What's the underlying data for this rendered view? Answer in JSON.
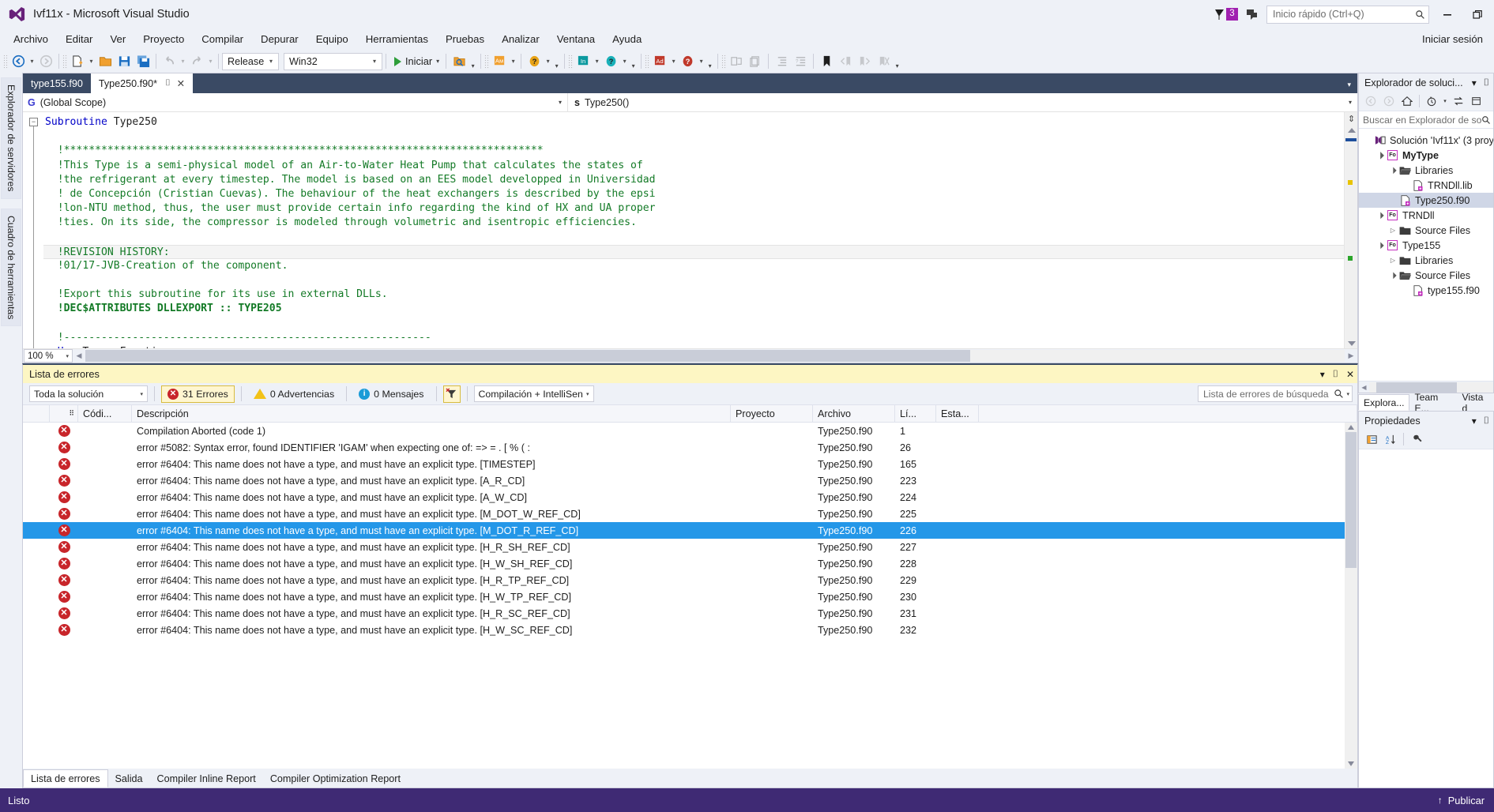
{
  "window": {
    "title": "Ivf11x - Microsoft Visual Studio",
    "logo_icon": "visual-studio-logo",
    "notifications": {
      "flag_icon": "flag-icon",
      "count": "3"
    },
    "feedback_icon": "feedback-icon",
    "quick_launch": {
      "placeholder": "Inicio rápido (Ctrl+Q)",
      "value": "",
      "search_icon": "search-icon"
    },
    "minimize": "—",
    "restore": "❐"
  },
  "menu": {
    "items": [
      "Archivo",
      "Editar",
      "Ver",
      "Proyecto",
      "Compilar",
      "Depurar",
      "Equipo",
      "Herramientas",
      "Pruebas",
      "Analizar",
      "Ventana",
      "Ayuda"
    ],
    "signin": "Iniciar sesión"
  },
  "toolbar": {
    "nav_back_icon": "navigate-back-icon",
    "nav_forward_icon": "navigate-forward-icon",
    "new_project_icon": "new-project-icon",
    "open_file_icon": "open-file-icon",
    "save_icon": "save-icon",
    "save_all_icon": "save-all-icon",
    "undo_icon": "undo-icon",
    "redo_icon": "redo-icon",
    "configuration": "Release",
    "platform": "Win32",
    "start_label": "Iniciar",
    "start_icon": "play-icon",
    "find_icon": "find-in-files-icon",
    "am_icon": "ampere-tool-icon",
    "help1_icon": "help-icon",
    "in_icon": "intel-inspector-icon",
    "help2_icon": "help-icon",
    "ad_icon": "advisor-icon",
    "help3_icon": "help-icon",
    "comment_icon": "comment-icon",
    "uncomment_icon": "uncomment-icon",
    "indent_icon": "increase-indent-icon",
    "outdent_icon": "decrease-indent-icon",
    "bookmark_icon": "bookmark-icon",
    "prev_bookmark_icon": "previous-bookmark-icon",
    "next_bookmark_icon": "next-bookmark-icon",
    "clear_bookmark_icon": "clear-bookmarks-icon"
  },
  "left_dock": {
    "tabs": [
      "Explorador de servidores",
      "Cuadro de herramientas"
    ]
  },
  "editor": {
    "tabs": [
      {
        "label": "type155.f90",
        "active": false
      },
      {
        "label": "Type250.f90*",
        "active": true,
        "pin_icon": "pin-icon",
        "close_icon": "close-icon"
      }
    ],
    "scope_badge": "G",
    "scope_value": "(Global Scope)",
    "member_badge": "s",
    "member_value": "Type250()",
    "zoom": "100 %",
    "lines": [
      {
        "indent": 0,
        "fold": true,
        "parts": [
          {
            "t": "Subroutine ",
            "c": "kw"
          },
          {
            "t": "Type250",
            "c": "id"
          }
        ]
      },
      {
        "indent": 1,
        "parts": []
      },
      {
        "indent": 1,
        "parts": [
          {
            "t": "!*****************************************************************************",
            "c": "cm"
          }
        ]
      },
      {
        "indent": 1,
        "parts": [
          {
            "t": "!This Type is a semi-physical model of an Air-to-Water Heat Pump that calculates the states of",
            "c": "cm"
          }
        ]
      },
      {
        "indent": 1,
        "parts": [
          {
            "t": "!the refrigerant at every timestep. The model is based on an EES model developped in Universidad",
            "c": "cm"
          }
        ]
      },
      {
        "indent": 1,
        "parts": [
          {
            "t": "! de Concepción (Cristian Cuevas). The behaviour of the heat exchangers is described by the epsi",
            "c": "cm"
          }
        ]
      },
      {
        "indent": 1,
        "parts": [
          {
            "t": "!lon-NTU method, thus, the user must provide certain info regarding the kind of HX and UA proper",
            "c": "cm"
          }
        ]
      },
      {
        "indent": 1,
        "parts": [
          {
            "t": "!ties. On its side, the compressor is modeled through volumetric and isentropic efficiencies.",
            "c": "cm"
          }
        ]
      },
      {
        "indent": 1,
        "parts": []
      },
      {
        "indent": 1,
        "current": true,
        "parts": [
          {
            "t": "!REVISION HISTORY:",
            "c": "cm"
          }
        ]
      },
      {
        "indent": 1,
        "parts": [
          {
            "t": "!01/17-JVB-Creation of the component.",
            "c": "cm"
          }
        ]
      },
      {
        "indent": 1,
        "parts": []
      },
      {
        "indent": 1,
        "parts": [
          {
            "t": "!Export this subroutine for its use in external DLLs.",
            "c": "cm"
          }
        ]
      },
      {
        "indent": 1,
        "parts": [
          {
            "t": "!DEC$ATTRIBUTES DLLEXPORT :: TYPE205",
            "c": "cm",
            "b": true
          }
        ]
      },
      {
        "indent": 1,
        "parts": []
      },
      {
        "indent": 1,
        "parts": [
          {
            "t": "!-----------------------------------------------------------",
            "c": "cm"
          }
        ]
      },
      {
        "indent": 1,
        "parts": [
          {
            "t": "Use ",
            "c": "kw"
          },
          {
            "t": "TrnsysFunctions",
            "c": "id"
          }
        ]
      }
    ]
  },
  "error_list": {
    "title": "Lista de errores",
    "dropdown_icon": "chevron-down-icon",
    "pin_icon": "pin-icon",
    "close_icon": "close-icon",
    "scope_filter": "Toda la solución",
    "errors_label": "31 Errores",
    "warnings_label": "0 Advertencias",
    "messages_label": "0 Mensajes",
    "filter_icon": "clear-filter-icon",
    "build_filter": "Compilación + IntelliSen",
    "search_placeholder": "Lista de errores de búsqueda",
    "search_icon": "search-icon",
    "columns": [
      "",
      "",
      "Códi...",
      "Descripción",
      "Proyecto",
      "Archivo",
      "Lí...",
      "Esta..."
    ],
    "rows": [
      {
        "code": "",
        "desc": "Compilation Aborted (code 1)",
        "project": "",
        "file": "Type250.f90",
        "line": "1",
        "state": "",
        "selected": false
      },
      {
        "code": "",
        "desc": "error #5082: Syntax error, found IDENTIFIER 'IGAM' when expecting one of: => = . [ % ( :",
        "project": "",
        "file": "Type250.f90",
        "line": "26",
        "state": "",
        "selected": false
      },
      {
        "code": "",
        "desc": "error #6404: This name does not have a type, and must have an explicit type.   [TIMESTEP]",
        "project": "",
        "file": "Type250.f90",
        "line": "165",
        "state": "",
        "selected": false
      },
      {
        "code": "",
        "desc": "error #6404: This name does not have a type, and must have an explicit type.   [A_R_CD]",
        "project": "",
        "file": "Type250.f90",
        "line": "223",
        "state": "",
        "selected": false
      },
      {
        "code": "",
        "desc": "error #6404: This name does not have a type, and must have an explicit type.   [A_W_CD]",
        "project": "",
        "file": "Type250.f90",
        "line": "224",
        "state": "",
        "selected": false
      },
      {
        "code": "",
        "desc": "error #6404: This name does not have a type, and must have an explicit type.   [M_DOT_W_REF_CD]",
        "project": "",
        "file": "Type250.f90",
        "line": "225",
        "state": "",
        "selected": false
      },
      {
        "code": "",
        "desc": "error #6404: This name does not have a type, and must have an explicit type.   [M_DOT_R_REF_CD]",
        "project": "",
        "file": "Type250.f90",
        "line": "226",
        "state": "",
        "selected": true
      },
      {
        "code": "",
        "desc": "error #6404: This name does not have a type, and must have an explicit type.   [H_R_SH_REF_CD]",
        "project": "",
        "file": "Type250.f90",
        "line": "227",
        "state": "",
        "selected": false
      },
      {
        "code": "",
        "desc": "error #6404: This name does not have a type, and must have an explicit type.   [H_W_SH_REF_CD]",
        "project": "",
        "file": "Type250.f90",
        "line": "228",
        "state": "",
        "selected": false
      },
      {
        "code": "",
        "desc": "error #6404: This name does not have a type, and must have an explicit type.   [H_R_TP_REF_CD]",
        "project": "",
        "file": "Type250.f90",
        "line": "229",
        "state": "",
        "selected": false
      },
      {
        "code": "",
        "desc": "error #6404: This name does not have a type, and must have an explicit type.   [H_W_TP_REF_CD]",
        "project": "",
        "file": "Type250.f90",
        "line": "230",
        "state": "",
        "selected": false
      },
      {
        "code": "",
        "desc": "error #6404: This name does not have a type, and must have an explicit type.   [H_R_SC_REF_CD]",
        "project": "",
        "file": "Type250.f90",
        "line": "231",
        "state": "",
        "selected": false
      },
      {
        "code": "",
        "desc": "error #6404: This name does not have a type, and must have an explicit type.   [H_W_SC_REF_CD]",
        "project": "",
        "file": "Type250.f90",
        "line": "232",
        "state": "",
        "selected": false
      }
    ],
    "bottom_tabs": [
      {
        "label": "Lista de errores",
        "active": true
      },
      {
        "label": "Salida",
        "active": false
      },
      {
        "label": "Compiler Inline Report",
        "active": false
      },
      {
        "label": "Compiler Optimization Report",
        "active": false
      }
    ]
  },
  "solution_explorer": {
    "title": "Explorador de soluci...",
    "dropdown_icon": "chevron-down-icon",
    "pin_icon": "pin-icon",
    "toolbar": {
      "back_icon": "navigate-back-icon",
      "forward_icon": "navigate-forward-icon",
      "home_icon": "home-icon",
      "pending_changes_icon": "pending-changes-icon",
      "sync_icon": "sync-with-active-document-icon",
      "properties_icon": "properties-window-icon"
    },
    "search_placeholder": "Buscar en Explorador de so",
    "search_icon": "search-icon",
    "tree": [
      {
        "depth": 0,
        "twisty": "",
        "icon": "solution-icon",
        "label": "Solución 'Ivf11x'  (3 proy",
        "bold": false,
        "selected": false
      },
      {
        "depth": 1,
        "twisty": "expanded",
        "icon": "fortran-project-icon",
        "label": "MyType",
        "bold": true,
        "selected": false
      },
      {
        "depth": 2,
        "twisty": "expanded",
        "icon": "folder-open-icon",
        "label": "Libraries",
        "bold": false,
        "selected": false
      },
      {
        "depth": 3,
        "twisty": "",
        "icon": "file-icon",
        "label": "TRNDll.lib",
        "bold": false,
        "selected": false
      },
      {
        "depth": 2,
        "twisty": "",
        "icon": "file-icon",
        "label": "Type250.f90",
        "bold": false,
        "selected": true
      },
      {
        "depth": 1,
        "twisty": "expanded",
        "icon": "fortran-project-icon",
        "label": "TRNDll",
        "bold": false,
        "selected": false
      },
      {
        "depth": 2,
        "twisty": "collapsed",
        "icon": "folder-icon",
        "label": "Source Files",
        "bold": false,
        "selected": false
      },
      {
        "depth": 1,
        "twisty": "expanded",
        "icon": "fortran-project-icon",
        "label": "Type155",
        "bold": false,
        "selected": false
      },
      {
        "depth": 2,
        "twisty": "collapsed",
        "icon": "folder-icon",
        "label": "Libraries",
        "bold": false,
        "selected": false
      },
      {
        "depth": 2,
        "twisty": "expanded",
        "icon": "folder-open-icon",
        "label": "Source Files",
        "bold": false,
        "selected": false
      },
      {
        "depth": 3,
        "twisty": "",
        "icon": "file-icon",
        "label": "type155.f90",
        "bold": false,
        "selected": false
      }
    ],
    "tabs": [
      {
        "label": "Explora...",
        "active": true
      },
      {
        "label": "Team E...",
        "active": false
      },
      {
        "label": "Vista d",
        "active": false
      }
    ]
  },
  "properties": {
    "title": "Propiedades",
    "dropdown_icon": "chevron-down-icon",
    "pin_icon": "pin-icon",
    "categorized_icon": "categorized-view-icon",
    "alphabetical_icon": "alphabetical-view-icon",
    "properties_icon": "properties-page-icon"
  },
  "status": {
    "text": "Listo",
    "publish_label": "Publicar",
    "publish_icon": "up-arrow-icon"
  },
  "colors": {
    "accent_purple": "#3f2a74",
    "tab_strip": "#3a4a64",
    "selection_blue": "#2497e8",
    "error_red": "#c8252a",
    "warning_yellow": "#f2c218",
    "info_blue": "#1a9bd7",
    "comment_green": "#137a26",
    "keyword_blue": "#0000c8",
    "notif_purple": "#a020b0",
    "panel_yellow": "#fdf6c3",
    "chrome_bg": "#eef1f7"
  }
}
